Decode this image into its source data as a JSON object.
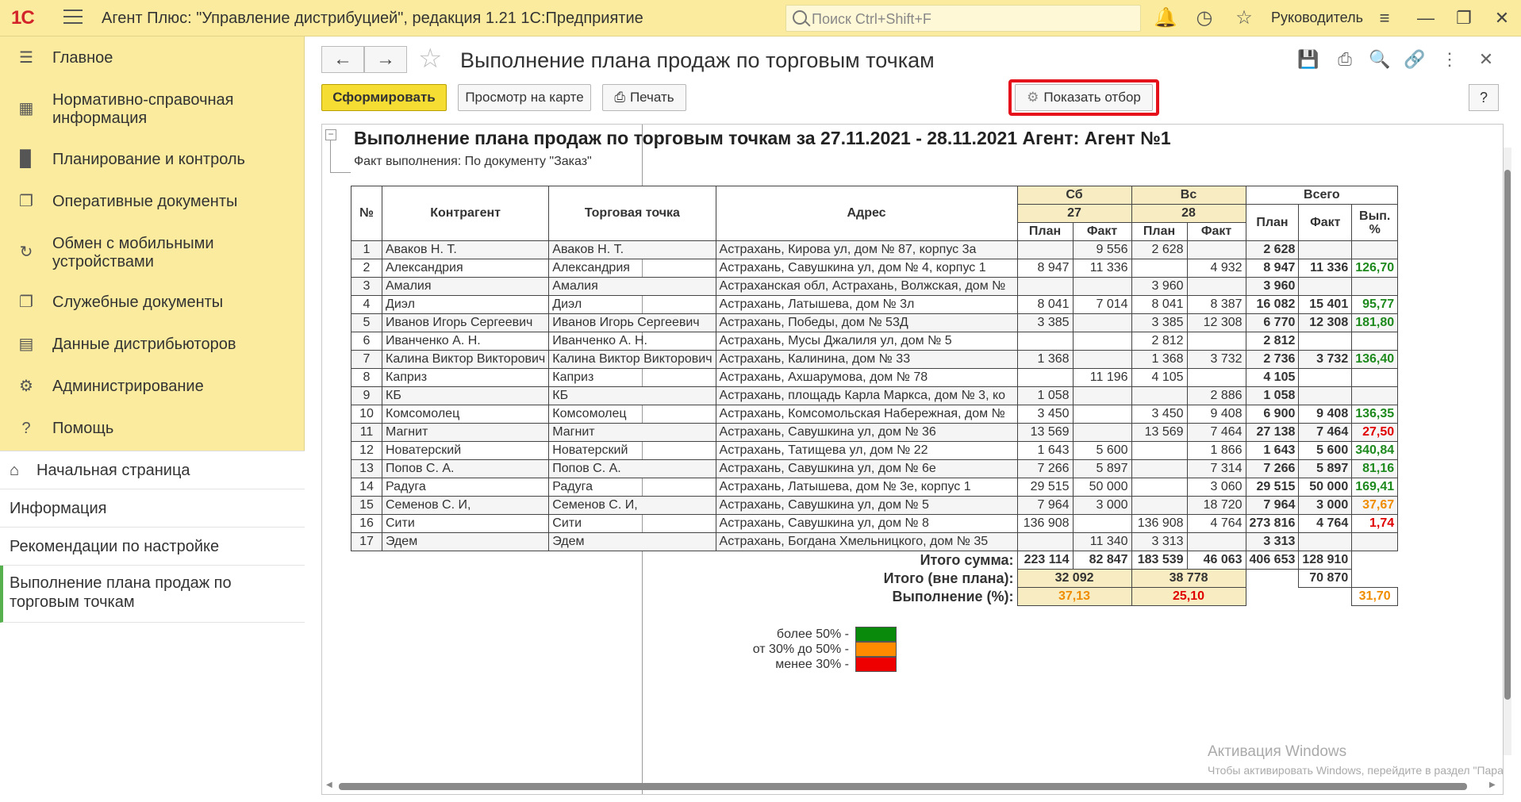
{
  "topbar": {
    "logo": "1С",
    "title": "Агент Плюс: \"Управление дистрибуцией\", редакция 1.21 1С:Предприятие",
    "search_placeholder": "Поиск Ctrl+Shift+F",
    "user": "Руководитель",
    "icons": [
      "bell-icon",
      "history-icon",
      "star-icon",
      "menu-lines-icon"
    ]
  },
  "sidebar": {
    "sections": [
      {
        "label": "Главное",
        "icon": "menu-lines-icon"
      },
      {
        "label": "Нормативно-справочная информация",
        "icon": "grid-icon"
      },
      {
        "label": "Планирование и контроль",
        "icon": "bar-chart-icon"
      },
      {
        "label": "Оперативные документы",
        "icon": "documents-icon"
      },
      {
        "label": "Обмен с мобильными устройствами",
        "icon": "sync-icon"
      },
      {
        "label": "Служебные документы",
        "icon": "documents-icon"
      },
      {
        "label": "Данные дистрибьюторов",
        "icon": "data-icon"
      },
      {
        "label": "Администрирование",
        "icon": "gear-icon"
      },
      {
        "label": "Помощь",
        "icon": "question-icon"
      }
    ],
    "open_windows": [
      {
        "label": "Начальная страница",
        "icon": "home-icon"
      },
      {
        "label": "Информация"
      },
      {
        "label": "Рекомендации по настройке"
      },
      {
        "label": "Выполнение плана продаж по торговым точкам",
        "active": true
      }
    ]
  },
  "main": {
    "title": "Выполнение плана продаж по торговым точкам",
    "buttons": {
      "generate": "Сформировать",
      "map": "Просмотр на карте",
      "print": "Печать",
      "filter": "Показать отбор",
      "help": "?"
    }
  },
  "report": {
    "title": "Выполнение плана продаж по торговым точкам за 27.11.2021 - 28.11.2021    Агент: Агент №1",
    "subtitle": "Факт выполнения: По документу \"Заказ\"",
    "headers": {
      "num": "№",
      "counterparty": "Контрагент",
      "outlet": "Торговая точка",
      "address": "Адрес",
      "day1_name": "Сб",
      "day1_date": "27",
      "day2_name": "Вс",
      "day2_date": "28",
      "total": "Всего",
      "plan": "План",
      "fact": "Факт",
      "pct": "Вып. %"
    },
    "rows": [
      {
        "n": "1",
        "ka": "Аваков Н. Т.",
        "tt": "Аваков Н. Т.",
        "addr": "Астрахань, Кирова ул, дом № 87, корпус 3а",
        "p1": "",
        "f1": "9 556",
        "p2": "2 628",
        "f2": "",
        "tp": "2 628",
        "tf": "",
        "pct": "",
        "cls": ""
      },
      {
        "n": "2",
        "ka": "Александрия",
        "tt": "Александрия",
        "addr": "Астрахань, Савушкина ул, дом № 4, корпус 1",
        "p1": "8 947",
        "f1": "11 336",
        "p2": "",
        "f2": "4 932",
        "tp": "8 947",
        "tf": "11 336",
        "pct": "126,70",
        "cls": "g"
      },
      {
        "n": "3",
        "ka": "Амалия",
        "tt": "Амалия",
        "addr": "Астраханская обл, Астрахань, Волжская, дом №",
        "p1": "",
        "f1": "",
        "p2": "3 960",
        "f2": "",
        "tp": "3 960",
        "tf": "",
        "pct": "",
        "cls": ""
      },
      {
        "n": "4",
        "ka": "Диэл",
        "tt": "Диэл",
        "addr": "Астрахань, Латышева, дом № 3л",
        "p1": "8 041",
        "f1": "7 014",
        "p2": "8 041",
        "f2": "8 387",
        "tp": "16 082",
        "tf": "15 401",
        "pct": "95,77",
        "cls": "g"
      },
      {
        "n": "5",
        "ka": "Иванов Игорь Сергеевич",
        "tt": "Иванов Игорь Сергеевич",
        "addr": "Астрахань, Победы, дом № 53Д",
        "p1": "3 385",
        "f1": "",
        "p2": "3 385",
        "f2": "12 308",
        "tp": "6 770",
        "tf": "12 308",
        "pct": "181,80",
        "cls": "g"
      },
      {
        "n": "6",
        "ka": "Иванченко А. Н.",
        "tt": "Иванченко А. Н.",
        "addr": "Астрахань, Мусы Джалиля ул, дом № 5",
        "p1": "",
        "f1": "",
        "p2": "2 812",
        "f2": "",
        "tp": "2 812",
        "tf": "",
        "pct": "",
        "cls": ""
      },
      {
        "n": "7",
        "ka": "Калина Виктор Викторович",
        "tt": "Калина Виктор Викторович",
        "addr": "Астрахань, Калинина, дом № 33",
        "p1": "1 368",
        "f1": "",
        "p2": "1 368",
        "f2": "3 732",
        "tp": "2 736",
        "tf": "3 732",
        "pct": "136,40",
        "cls": "g"
      },
      {
        "n": "8",
        "ka": "Каприз",
        "tt": "Каприз",
        "addr": "Астрахань, Ахшарумова, дом № 78",
        "p1": "",
        "f1": "11 196",
        "p2": "4 105",
        "f2": "",
        "tp": "4 105",
        "tf": "",
        "pct": "",
        "cls": ""
      },
      {
        "n": "9",
        "ka": "КБ",
        "tt": "КБ",
        "addr": "Астрахань, площадь Карла Маркса, дом № 3, ко",
        "p1": "1 058",
        "f1": "",
        "p2": "",
        "f2": "2 886",
        "tp": "1 058",
        "tf": "",
        "pct": "",
        "cls": ""
      },
      {
        "n": "10",
        "ka": "Комсомолец",
        "tt": "Комсомолец",
        "addr": "Астрахань, Комсомольская Набережная, дом №",
        "p1": "3 450",
        "f1": "",
        "p2": "3 450",
        "f2": "9 408",
        "tp": "6 900",
        "tf": "9 408",
        "pct": "136,35",
        "cls": "g"
      },
      {
        "n": "11",
        "ka": "Магнит",
        "tt": "Магнит",
        "addr": "Астрахань, Савушкина ул, дом № 36",
        "p1": "13 569",
        "f1": "",
        "p2": "13 569",
        "f2": "7 464",
        "tp": "27 138",
        "tf": "7 464",
        "pct": "27,50",
        "cls": "r"
      },
      {
        "n": "12",
        "ka": "Новатерский",
        "tt": "Новатерский",
        "addr": "Астрахань, Татищева ул, дом № 22",
        "p1": "1 643",
        "f1": "5 600",
        "p2": "",
        "f2": "1 866",
        "tp": "1 643",
        "tf": "5 600",
        "pct": "340,84",
        "cls": "g"
      },
      {
        "n": "13",
        "ka": "Попов С. А.",
        "tt": "Попов С. А.",
        "addr": "Астрахань, Савушкина ул, дом № 6е",
        "p1": "7 266",
        "f1": "5 897",
        "p2": "",
        "f2": "7 314",
        "tp": "7 266",
        "tf": "5 897",
        "pct": "81,16",
        "cls": "g"
      },
      {
        "n": "14",
        "ka": "Радуга",
        "tt": "Радуга",
        "addr": "Астрахань, Латышева, дом № 3е, корпус 1",
        "p1": "29 515",
        "f1": "50 000",
        "p2": "",
        "f2": "3 060",
        "tp": "29 515",
        "tf": "50 000",
        "pct": "169,41",
        "cls": "g"
      },
      {
        "n": "15",
        "ka": "Семенов С. И,",
        "tt": "Семенов С. И,",
        "addr": "Астрахань, Савушкина ул, дом № 5",
        "p1": "7 964",
        "f1": "3 000",
        "p2": "",
        "f2": "18 720",
        "tp": "7 964",
        "tf": "3 000",
        "pct": "37,67",
        "cls": "o"
      },
      {
        "n": "16",
        "ka": "Сити",
        "tt": "Сити",
        "addr": "Астрахань, Савушкина ул, дом № 8",
        "p1": "136 908",
        "f1": "",
        "p2": "136 908",
        "f2": "4 764",
        "tp": "273 816",
        "tf": "4 764",
        "pct": "1,74",
        "cls": "r"
      },
      {
        "n": "17",
        "ka": "Эдем",
        "tt": "Эдем",
        "addr": "Астрахань, Богдана Хмельницкого, дом № 35",
        "p1": "",
        "f1": "11 340",
        "p2": "3 313",
        "f2": "",
        "tp": "3 313",
        "tf": "",
        "pct": "",
        "cls": ""
      }
    ],
    "totals": {
      "sum_label": "Итого сумма:",
      "p1": "223 114",
      "f1": "82 847",
      "p2": "183 539",
      "f2": "46 063",
      "tp": "406 653",
      "tf": "128 910",
      "outside_label": "Итого (вне плана):",
      "out1": "32 092",
      "out2": "38 778",
      "out_total": "70 870",
      "exec_label": "Выполнение (%):",
      "exec1": "37,13",
      "exec2": "25,10",
      "exec_total": "31,70"
    },
    "legend": [
      {
        "label": "более 50% -",
        "color": "#0a8a0a"
      },
      {
        "label": "от 30% до 50% -",
        "color": "#ff8c00"
      },
      {
        "label": "менее 30% -",
        "color": "#ee0000"
      }
    ]
  },
  "watermark": {
    "line1": "Активация Windows",
    "line2": "Чтобы активировать Windows, перейдите в раздел \"Параметры\"."
  }
}
